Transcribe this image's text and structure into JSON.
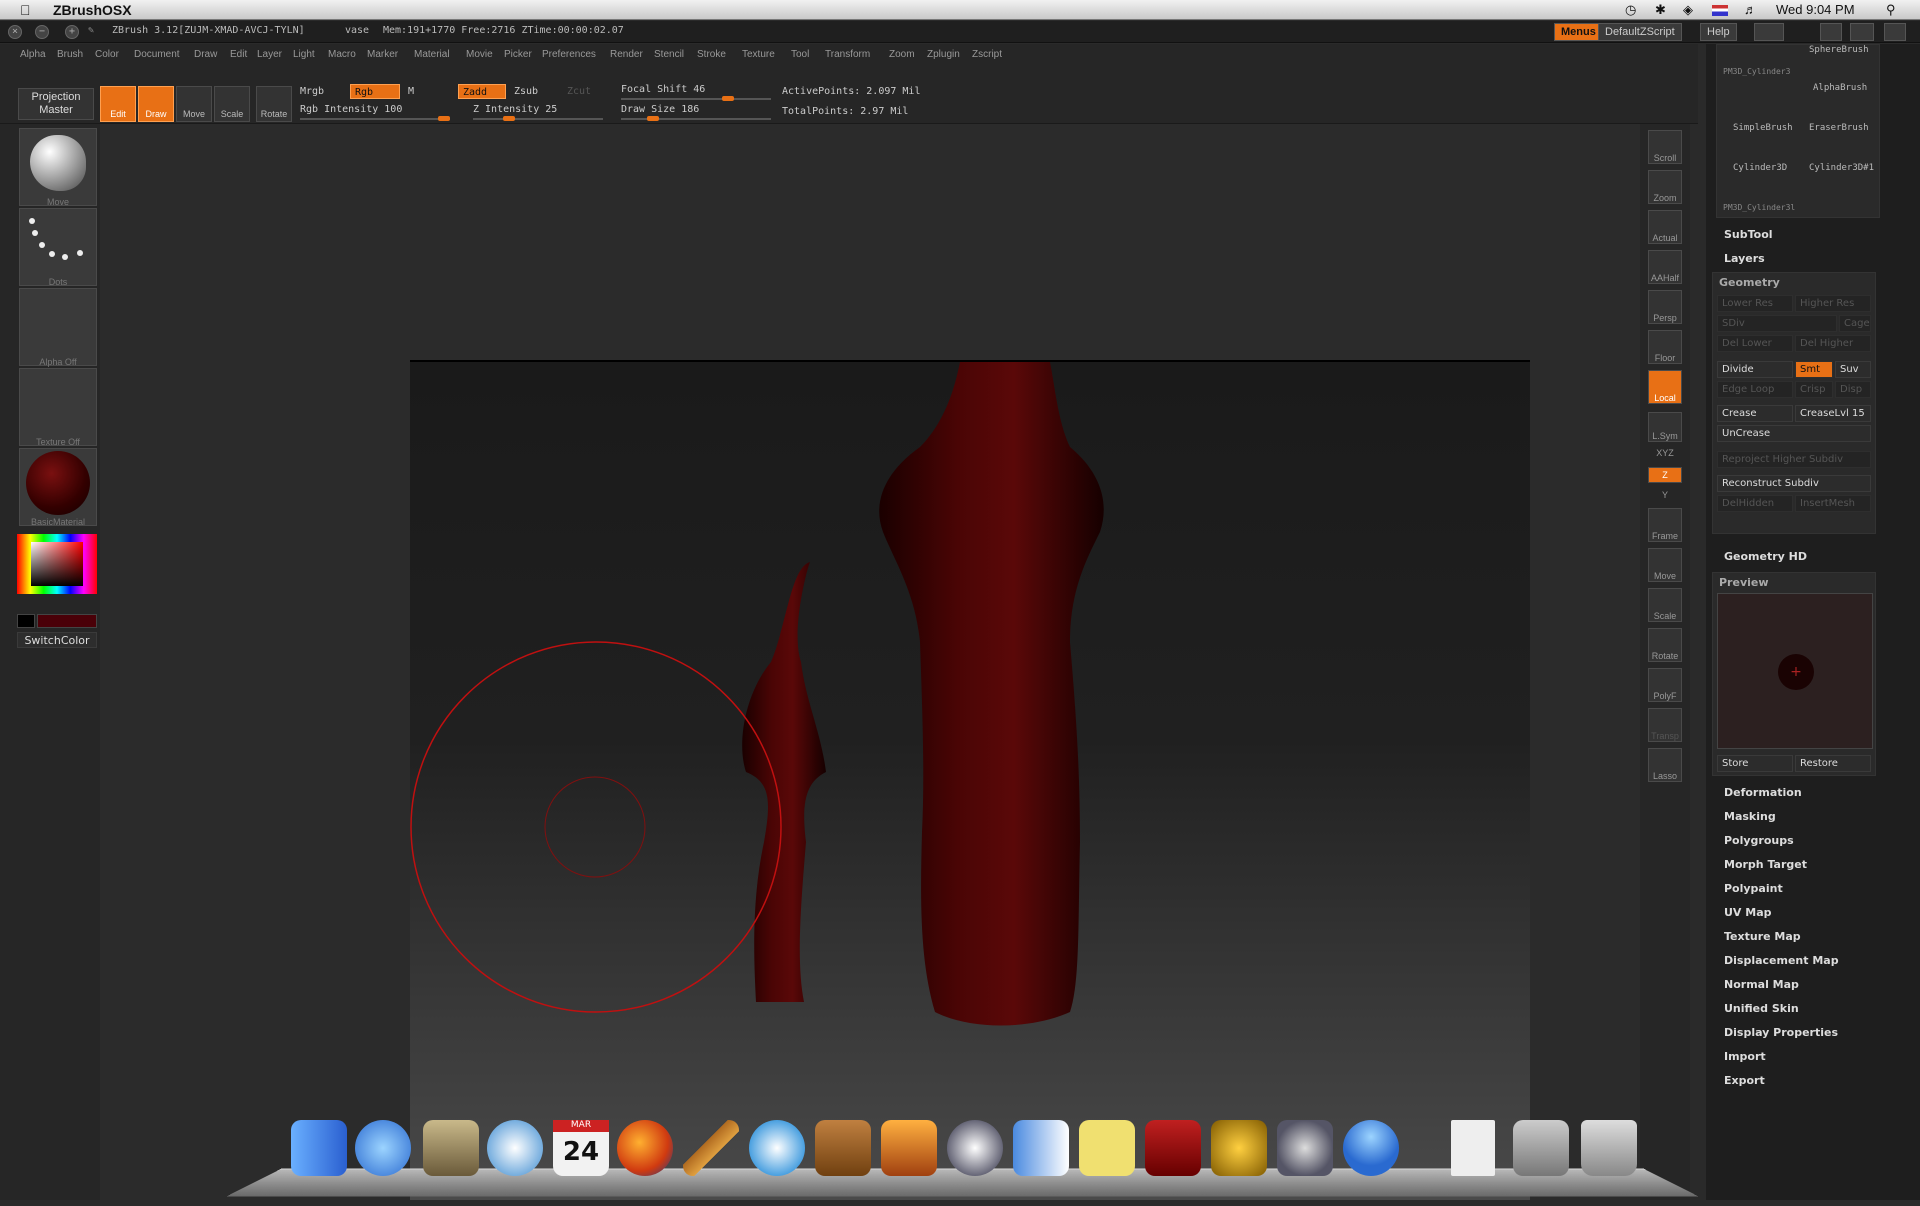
{
  "menubar": {
    "app_name": "ZBrushOSX",
    "clock": "Wed 9:04 PM"
  },
  "titlebar": {
    "title": "ZBrush 3.12[ZUJM-XMAD-AVCJ-TYLN]",
    "doc_name": "vase",
    "status": "Mem:191+1770 Free:2716 ZTime:00:00:02.07",
    "menus_btn": "Menus",
    "script_btn": "DefaultZScript",
    "help_btn": "Help"
  },
  "menus": [
    "Alpha",
    "Brush",
    "Color",
    "Document",
    "Draw",
    "Edit",
    "Layer",
    "Light",
    "Macro",
    "Marker",
    "Material",
    "Movie",
    "Picker",
    "Preferences",
    "Render",
    "Stencil",
    "Stroke",
    "Texture",
    "Tool",
    "Transform",
    "Zoom",
    "Zplugin",
    "Zscript"
  ],
  "shelf": {
    "projection_master": "Projection Master",
    "tools": [
      "Edit",
      "Draw",
      "Move",
      "Scale",
      "Rotate"
    ],
    "mrgb": "Mrgb",
    "rgb": "Rgb",
    "m": "M",
    "rgb_intensity_label": "Rgb Intensity 100",
    "rgb_intensity": 100,
    "zadd": "Zadd",
    "zsub": "Zsub",
    "zcut": "Zcut",
    "z_intensity_label": "Z Intensity 25",
    "z_intensity": 25,
    "focal_shift_label": "Focal Shift 46",
    "focal_shift": 46,
    "draw_size_label": "Draw Size 186",
    "draw_size": 186,
    "active_points": "ActivePoints: 2.097 Mil",
    "total_points": "TotalPoints: 2.97 Mil"
  },
  "left": {
    "move": "Move",
    "dots": "Dots",
    "alpha": "Alpha Off",
    "texture": "Texture Off",
    "material": "BasicMaterial",
    "switch_color": "SwitchColor"
  },
  "right_tools": [
    "Scroll",
    "Zoom",
    "Actual",
    "AAHalf",
    "Persp",
    "Floor",
    "Local",
    "L.Sym",
    "XYZ",
    "Y",
    "Z",
    "Frame",
    "Move",
    "Scale",
    "Rotate",
    "PolyF",
    "Transp",
    "Lasso"
  ],
  "tool_thumbs": [
    "SphereBrush",
    "PM3D_Cylinder3",
    "AlphaBrush",
    "SimpleBrush",
    "EraserBrush",
    "Cylinder3D",
    "Cylinder3D#1",
    "PM3D_Cylinder3l"
  ],
  "panel": {
    "subtool": "SubTool",
    "layers": "Layers",
    "geometry": "Geometry",
    "lower_res": "Lower Res",
    "higher_res": "Higher Res",
    "sdiv": "SDiv",
    "cage": "Cage",
    "del_lower": "Del Lower",
    "del_higher": "Del Higher",
    "divide": "Divide",
    "smt": "Smt",
    "suv": "Suv",
    "edge_loop": "Edge Loop",
    "crisp": "Crisp",
    "disp": "Disp",
    "crease": "Crease",
    "crease_lvl": "CreaseLvl 15",
    "uncrease": "UnCrease",
    "reproject": "Reproject Higher Subdiv",
    "reconstruct": "Reconstruct Subdiv",
    "del_hidden": "DelHidden",
    "insert_mesh": "InsertMesh",
    "geometry_hd": "Geometry HD",
    "preview": "Preview",
    "store": "Store",
    "restore": "Restore",
    "sections": [
      "Deformation",
      "Masking",
      "Polygroups",
      "Morph Target",
      "Polypaint",
      "UV Map",
      "Texture Map",
      "Displacement Map",
      "Normal Map",
      "Unified Skin",
      "Display Properties",
      "Import",
      "Export"
    ]
  },
  "dock": {
    "calendar_month": "MAR",
    "calendar_day": "24"
  }
}
